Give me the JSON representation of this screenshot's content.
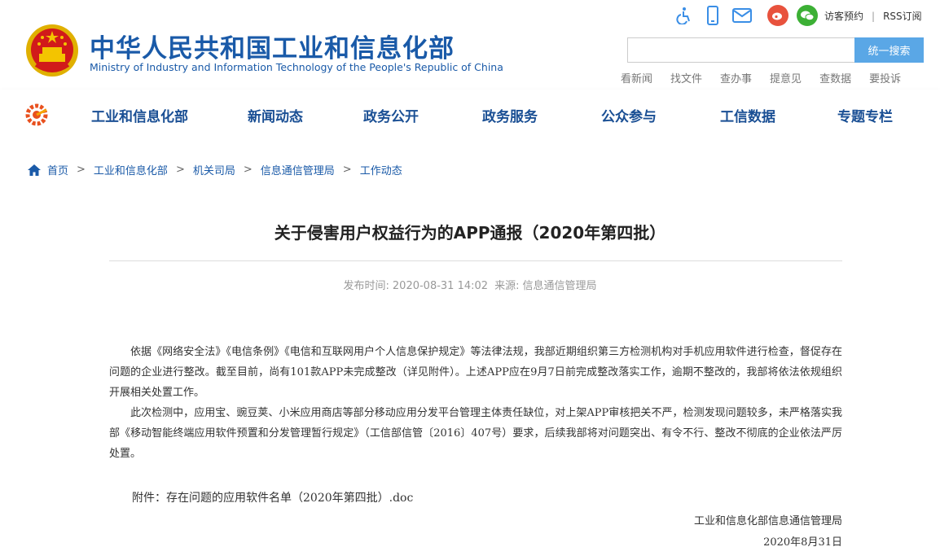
{
  "header": {
    "site_title": "中华人民共和国工业和信息化部",
    "site_subtitle": "Ministry of Industry and Information Technology of the People's Republic of China",
    "util_links": {
      "visit": "访客预约",
      "rss": "RSS订阅"
    },
    "search": {
      "placeholder": "",
      "button_label": "统一搜索"
    },
    "quick_links": [
      "看新闻",
      "找文件",
      "查办事",
      "提意见",
      "查数据",
      "要投诉"
    ]
  },
  "nav": {
    "items": [
      "工业和信息化部",
      "新闻动态",
      "政务公开",
      "政务服务",
      "公众参与",
      "工信数据",
      "专题专栏"
    ]
  },
  "breadcrumb": [
    "首页",
    "工业和信息化部",
    "机关司局",
    "信息通信管理局",
    "工作动态"
  ],
  "article": {
    "title": "关于侵害用户权益行为的APP通报（2020年第四批）",
    "meta": {
      "publish_label": "发布时间:",
      "publish_time": "2020-08-31 14:02",
      "source_label": "来源:",
      "source": "信息通信管理局"
    },
    "paragraphs": [
      "依据《网络安全法》《电信条例》《电信和互联网用户个人信息保护规定》等法律法规，我部近期组织第三方检测机构对手机应用软件进行检查，督促存在问题的企业进行整改。截至目前，尚有101款APP未完成整改（详见附件）。上述APP应在9月7日前完成整改落实工作，逾期不整改的，我部将依法依规组织开展相关处置工作。",
      "此次检测中，应用宝、豌豆荚、小米应用商店等部分移动应用分发平台管理主体责任缺位，对上架APP审核把关不严，检测发现问题较多，未严格落实我部《移动智能终端应用软件预置和分发管理暂行规定》（工信部信管〔2016〕407号）要求，后续我部将对问题突出、有令不行、整改不彻底的企业依法严厉处置。"
    ],
    "attachment": {
      "label": "附件：",
      "filename": "存在问题的应用软件名单（2020年第四批）.doc"
    },
    "signature": {
      "org": "工业和信息化部信息通信管理局",
      "date": "2020年8月31日"
    }
  },
  "colors": {
    "brand_blue": "#1a5aa8",
    "search_button": "#5aa7e6",
    "weibo": "#e8523d",
    "wechat": "#3cb035"
  },
  "icons": [
    "accessibility-icon",
    "mobile-icon",
    "mail-icon",
    "weibo-icon",
    "wechat-icon",
    "home-icon",
    "national-emblem",
    "nav-logo"
  ]
}
